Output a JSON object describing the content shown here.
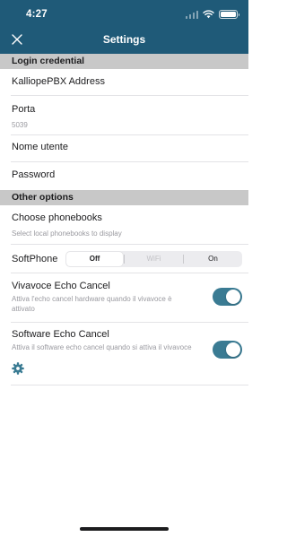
{
  "status_bar": {
    "time": "4:27"
  },
  "nav": {
    "title": "Settings",
    "close_icon": "close-icon"
  },
  "sections": {
    "login": "Login credential",
    "other": "Other options"
  },
  "login": {
    "address_label": "KalliopePBX Address",
    "port_label": "Porta",
    "port_value": "5039",
    "username_label": "Nome utente",
    "password_label": "Password"
  },
  "other": {
    "phonebooks_label": "Choose phonebooks",
    "phonebooks_sub": "Select local phonebooks to display",
    "softphone_label": "SoftPhone",
    "softphone_options": [
      "Off",
      "WiFi",
      "On"
    ],
    "softphone_selected": "Off",
    "vivavoce_label": "Vivavoce Echo Cancel",
    "vivavoce_sub": "Attiva l'echo cancel hardware quando il vivavoce è attivato",
    "vivavoce_on": true,
    "software_label": "Software Echo Cancel",
    "software_sub": "Attiva il software echo cancel quando si attiva il vivavoce",
    "software_on": true,
    "gear_icon": "gear-icon"
  },
  "colors": {
    "header_bg": "#1f5a78",
    "section_bg": "#c8c8c8",
    "toggle_on": "#3a7b93",
    "gear": "#3a7b93"
  }
}
